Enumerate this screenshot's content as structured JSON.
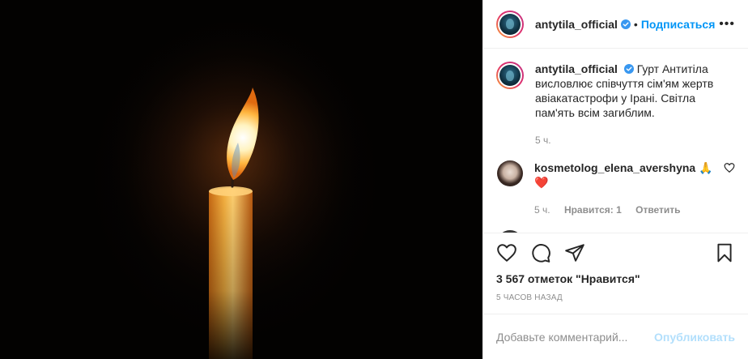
{
  "colors": {
    "accent": "#0095f6",
    "text": "#262626",
    "muted": "#8e8e8e",
    "post_disabled": "#b2dffc",
    "like_red": "#ed4956"
  },
  "header": {
    "username": "antytila_official",
    "dot": "•",
    "follow_label": "Подписаться",
    "more": "•••"
  },
  "caption": {
    "username": "antytila_official",
    "text": "Гурт Антитіла висловлює співчуття сім'ям жертв авіакатастрофи у Ірані. Світла пам'ять всім загиблим.",
    "time": "5 ч."
  },
  "comments": [
    {
      "username": "kosmetolog_elena_avershyna",
      "text": "🙏 ❤️",
      "time": "5 ч.",
      "likes": "Нравится: 1",
      "reply_label": "Ответить"
    }
  ],
  "actions": {
    "icons": [
      "heart-icon",
      "comment-icon",
      "share-icon",
      "bookmark-icon"
    ]
  },
  "likes_text": "3 567 отметок \"Нравится\"",
  "timestamp": "5 часов назад",
  "add_comment": {
    "placeholder": "Добавьте комментарий...",
    "post_label": "Опубликовать"
  }
}
